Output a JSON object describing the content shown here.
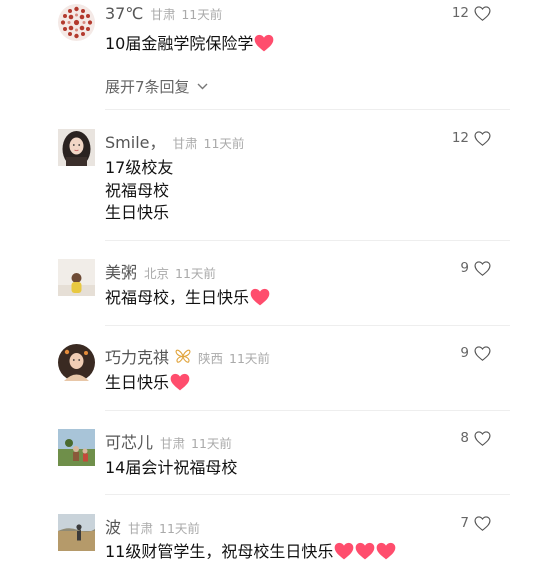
{
  "comments": [
    {
      "name": "37℃",
      "region": "甘肃",
      "time": "11天前",
      "likes": "12",
      "lines": [
        "10届金融学院保险学"
      ],
      "heart_count": 1,
      "replies_label": "展开7条回复"
    },
    {
      "name": "Smile，",
      "region": "甘肃",
      "time": "11天前",
      "likes": "12",
      "lines": [
        "17级校友",
        "祝福母校",
        "生日快乐"
      ],
      "heart_count": 0
    },
    {
      "name": "美粥",
      "region": "北京",
      "time": "11天前",
      "likes": "9",
      "lines": [
        "祝福母校，生日快乐"
      ],
      "heart_count": 1
    },
    {
      "name": "巧力克祺",
      "region": "陕西",
      "time": "11天前",
      "likes": "9",
      "lines": [
        "生日快乐"
      ],
      "heart_count": 1,
      "badge_icon": "butterfly-icon"
    },
    {
      "name": "可芯儿",
      "region": "甘肃",
      "time": "11天前",
      "likes": "8",
      "lines": [
        "14届会计祝福母校"
      ],
      "heart_count": 0
    },
    {
      "name": "波",
      "region": "甘肃",
      "time": "11天前",
      "likes": "7",
      "lines": [
        "11级财管学生，祝母校生日快乐"
      ],
      "heart_count": 3
    }
  ],
  "colors": {
    "heart": "#ff4d6d",
    "meta_text": "#aaaaaa",
    "name_text": "#555555",
    "badge": "#e0a33a"
  }
}
